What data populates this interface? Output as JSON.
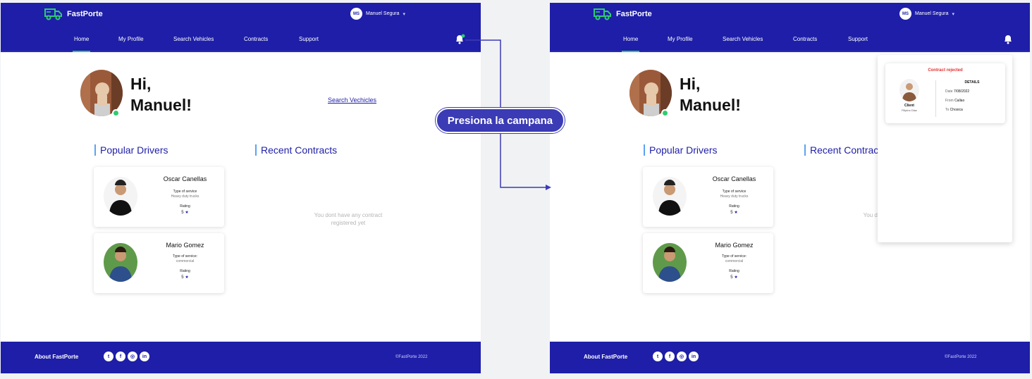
{
  "app": {
    "name": "FastPorte"
  },
  "user": {
    "initials": "MS",
    "name": "Manuel Segura"
  },
  "nav": [
    "Home",
    "My Profile",
    "Search Vehicles",
    "Contracts",
    "Support"
  ],
  "greeting": {
    "line1": "Hi,",
    "line2": "Manuel!"
  },
  "search_link": "Search Vechicles",
  "sections": {
    "drivers": "Popular Drivers",
    "contracts": "Recent Contracts"
  },
  "empty_contracts": {
    "line1": "You dont have any contract",
    "line2": "registered yet"
  },
  "drivers": [
    {
      "name": "Oscar Canellas",
      "service_label": "Type of service",
      "service": "Heavy duty trucks",
      "rating_label": "Rating",
      "rating": "5"
    },
    {
      "name": "Mario Gomez",
      "service_label": "Type of service:",
      "service": "commercial",
      "rating_label": "Rating",
      "rating": "5"
    }
  ],
  "footer": {
    "about": "About FastPorte",
    "copyright": "©FastPorte 2022",
    "socials": [
      "twitter-icon",
      "facebook-icon",
      "instagram-icon",
      "linkedin-icon"
    ]
  },
  "notification": {
    "title": "Contract rejected",
    "client_label": "Client",
    "client_name": "Filipino Diaz",
    "details_label": "DETAILS",
    "date_label": "Date",
    "date": "7/08/2022",
    "from_label": "From",
    "from": "Callao",
    "to_label": "To",
    "to": "Chosica"
  },
  "annotation": {
    "callout": "Presiona la campana"
  },
  "colors": {
    "brand": "#1e1ea8",
    "accent": "#2ecc71",
    "reject": "#e23030",
    "callout": "#3b3bb5"
  }
}
